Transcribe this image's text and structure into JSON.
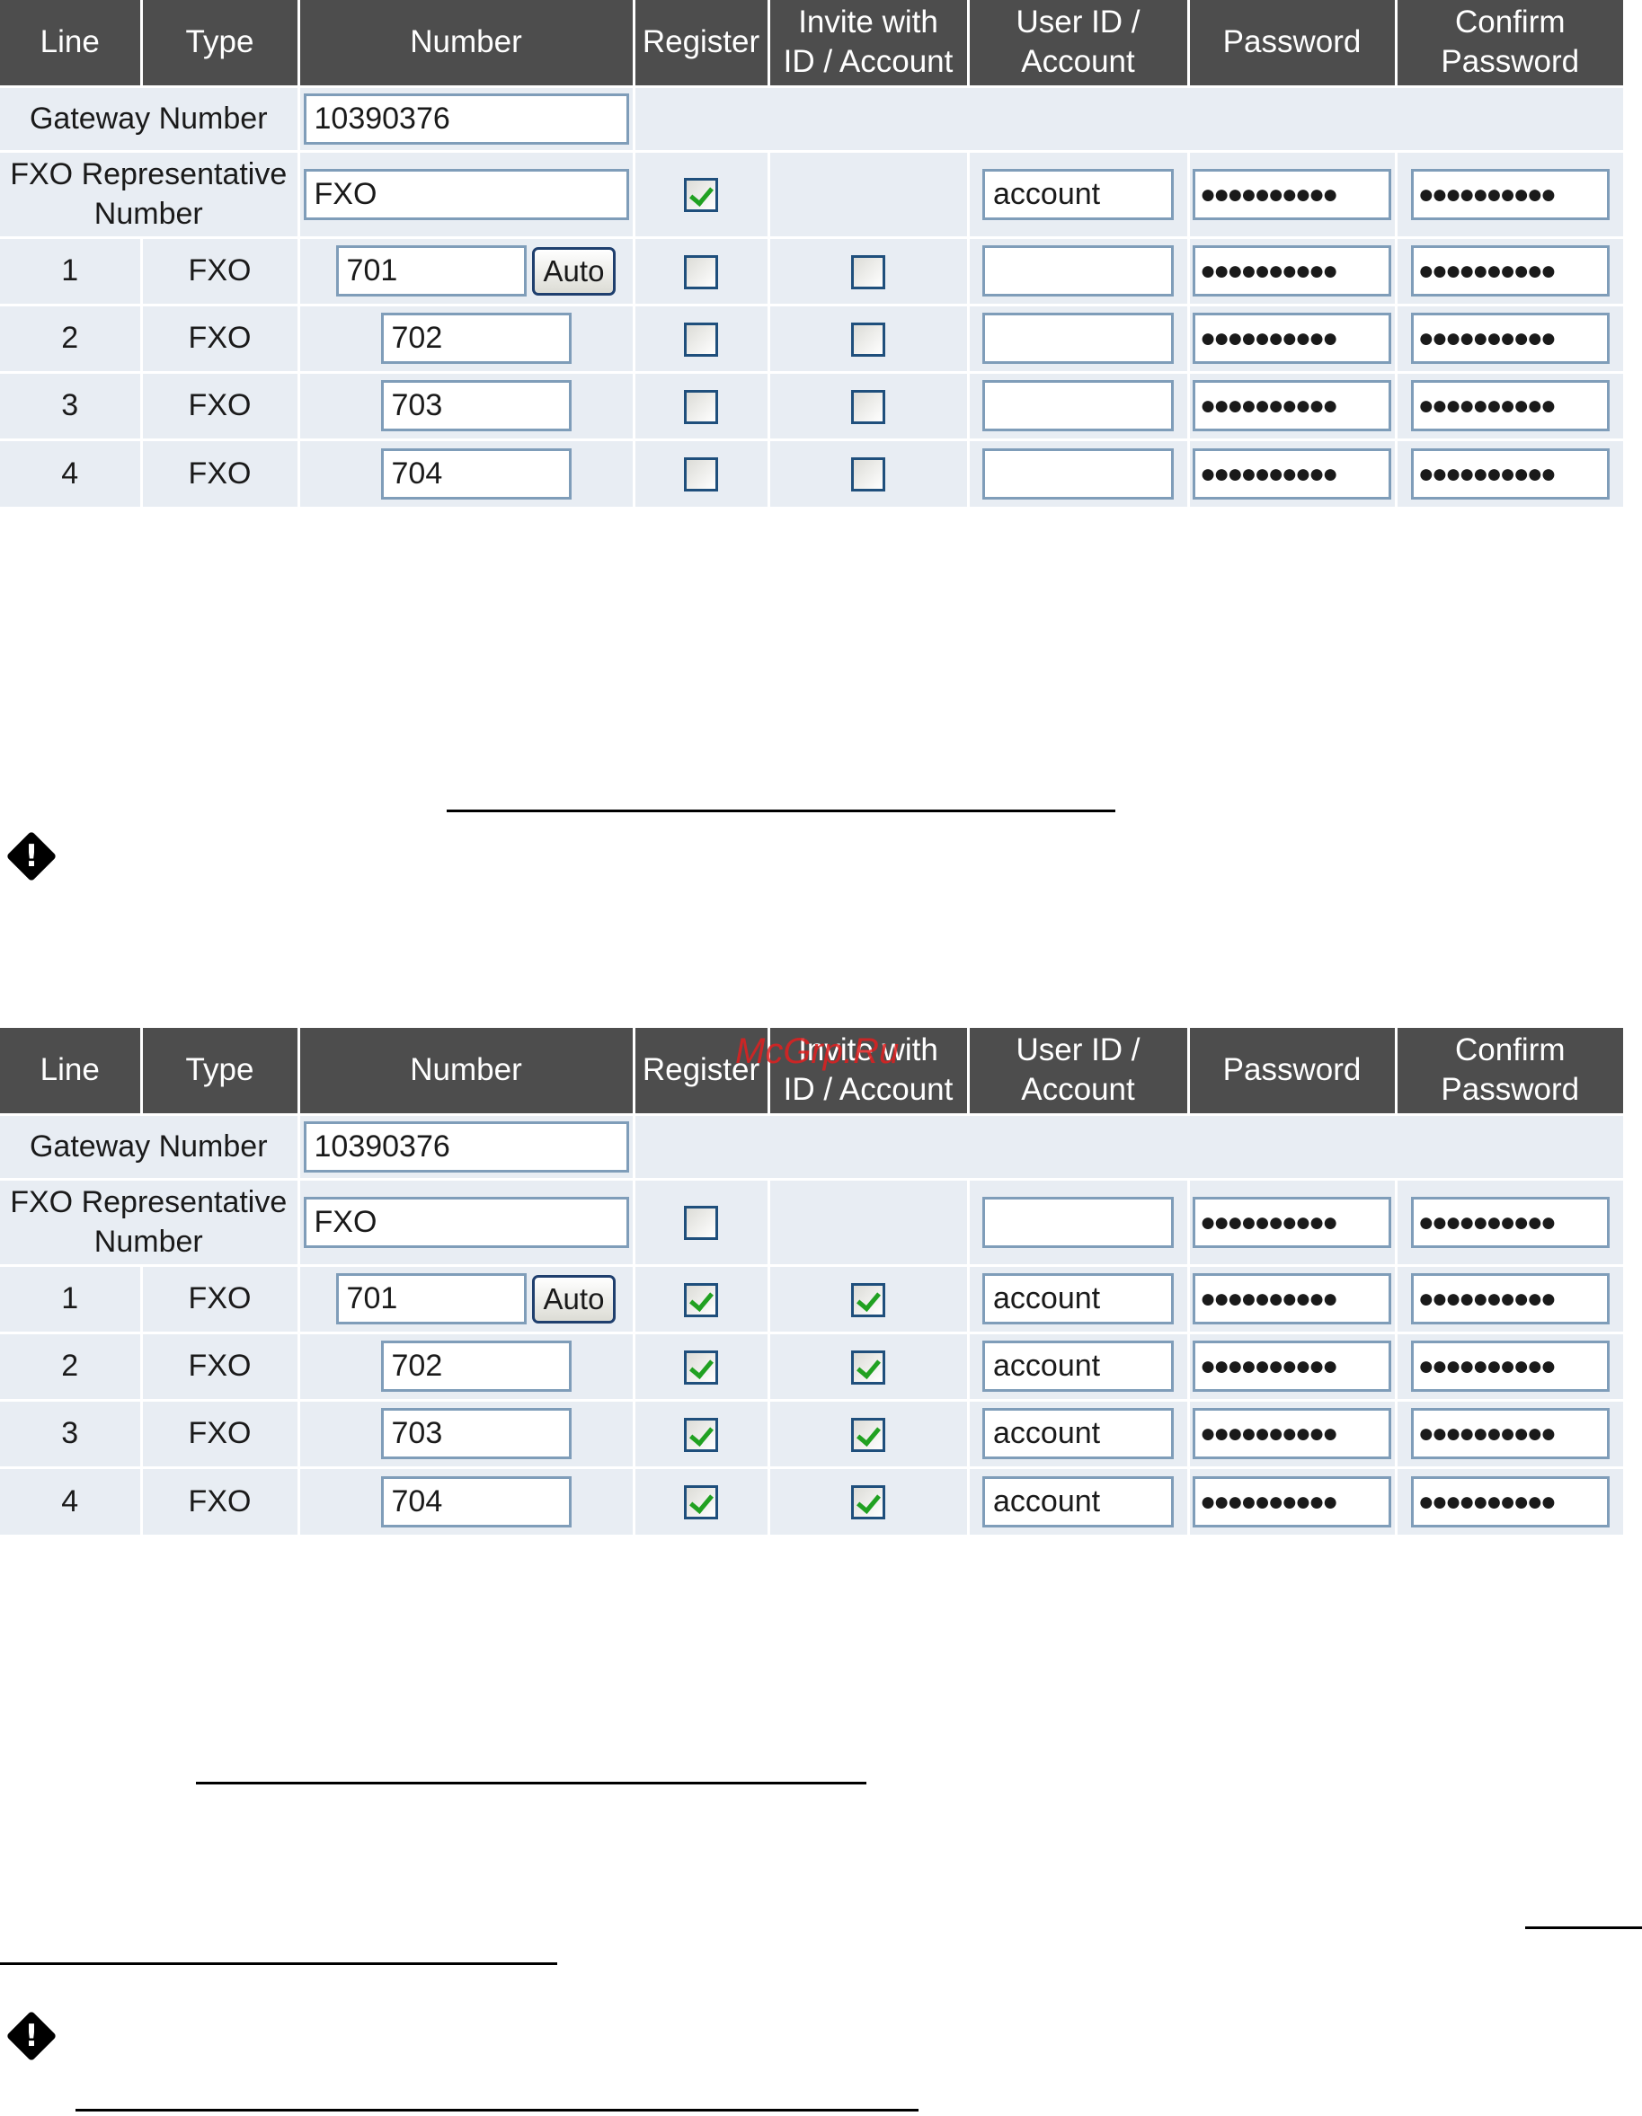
{
  "watermark": "McGrp.Ru",
  "headers": {
    "line": "Line",
    "type": "Type",
    "number": "Number",
    "register": "Register",
    "invite_1": "Invite with",
    "invite_2": "ID / Account",
    "userid_1": "User ID /",
    "userid_2": "Account",
    "password": "Password",
    "confirm_1": "Confirm",
    "confirm_2": "Password"
  },
  "labels": {
    "gateway": "Gateway Number",
    "rep_1": "FXO Representative",
    "rep_2": "Number",
    "auto_button": "Auto"
  },
  "panels": [
    {
      "gateway_number": "10390376",
      "representative": {
        "number": "FXO",
        "register": true,
        "user_id": "account",
        "password": "●●●●●●●●●●",
        "confirm": "●●●●●●●●●●"
      },
      "lines": [
        {
          "line": "1",
          "type": "FXO",
          "number": "701",
          "register": false,
          "invite": false,
          "user_id": "",
          "password": "●●●●●●●●●●",
          "confirm": "●●●●●●●●●●"
        },
        {
          "line": "2",
          "type": "FXO",
          "number": "702",
          "register": false,
          "invite": false,
          "user_id": "",
          "password": "●●●●●●●●●●",
          "confirm": "●●●●●●●●●●"
        },
        {
          "line": "3",
          "type": "FXO",
          "number": "703",
          "register": false,
          "invite": false,
          "user_id": "",
          "password": "●●●●●●●●●●",
          "confirm": "●●●●●●●●●●"
        },
        {
          "line": "4",
          "type": "FXO",
          "number": "704",
          "register": false,
          "invite": false,
          "user_id": "",
          "password": "●●●●●●●●●●",
          "confirm": "●●●●●●●●●●"
        }
      ]
    },
    {
      "gateway_number": "10390376",
      "representative": {
        "number": "FXO",
        "register": false,
        "user_id": "",
        "password": "●●●●●●●●●●",
        "confirm": "●●●●●●●●●●"
      },
      "lines": [
        {
          "line": "1",
          "type": "FXO",
          "number": "701",
          "register": true,
          "invite": true,
          "user_id": "account",
          "password": "●●●●●●●●●●",
          "confirm": "●●●●●●●●●●"
        },
        {
          "line": "2",
          "type": "FXO",
          "number": "702",
          "register": true,
          "invite": true,
          "user_id": "account",
          "password": "●●●●●●●●●●",
          "confirm": "●●●●●●●●●●"
        },
        {
          "line": "3",
          "type": "FXO",
          "number": "703",
          "register": true,
          "invite": true,
          "user_id": "account",
          "password": "●●●●●●●●●●",
          "confirm": "●●●●●●●●●●"
        },
        {
          "line": "4",
          "type": "FXO",
          "number": "704",
          "register": true,
          "invite": true,
          "user_id": "account",
          "password": "●●●●●●●●●●",
          "confirm": "●●●●●●●●●●"
        }
      ]
    }
  ],
  "warning_icon": "exclamation-diamond-icon"
}
